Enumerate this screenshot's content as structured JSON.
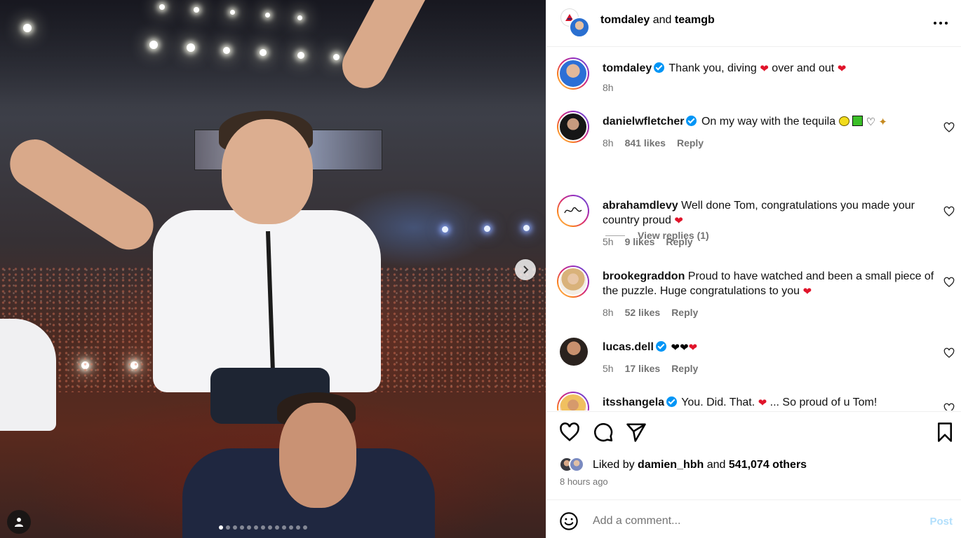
{
  "post": {
    "author_primary": "tomdaley",
    "joiner": "and",
    "author_secondary": "teamgb",
    "more_icon": "more-horizontal-icon"
  },
  "media": {
    "carousel_total": 13,
    "carousel_active_index": 0,
    "next_icon": "chevron-right-icon",
    "tag_icon": "user-tag-icon"
  },
  "caption": {
    "user": "tomdaley",
    "verified": true,
    "text_parts": [
      "Thank you, diving",
      "over and out"
    ],
    "time": "8h"
  },
  "comments": [
    {
      "user": "danielwfletcher",
      "verified": true,
      "text": "On my way with the tequila",
      "time": "8h",
      "likes": "841 likes",
      "reply": "Reply",
      "view_replies": "View replies (1)"
    },
    {
      "user": "abrahamdlevy",
      "verified": false,
      "text": "Well done Tom, congratulations you made your country proud",
      "time": "5h",
      "likes": "9 likes",
      "reply": "Reply"
    },
    {
      "user": "brookegraddon",
      "verified": false,
      "text": "Proud to have watched and been a small piece of the puzzle. Huge congratulations to you",
      "time": "8h",
      "likes": "52 likes",
      "reply": "Reply"
    },
    {
      "user": "lucas.dell",
      "verified": true,
      "text": "",
      "time": "5h",
      "likes": "17 likes",
      "reply": "Reply"
    },
    {
      "user": "itsshangela",
      "verified": true,
      "text_parts": [
        "You. Did. That.",
        "... So proud of u Tom!"
      ]
    }
  ],
  "actions": {
    "like_icon": "heart-icon",
    "comment_icon": "comment-icon",
    "share_icon": "send-icon",
    "save_icon": "bookmark-icon"
  },
  "likes_summary": {
    "prefix": "Liked by",
    "user": "damien_hbh",
    "joiner": "and",
    "others": "541,074 others",
    "time_ago": "8 hours ago"
  },
  "composer": {
    "placeholder": "Add a comment...",
    "post_label": "Post",
    "emoji_icon": "smiley-icon"
  },
  "colors": {
    "accent": "#0095f6",
    "post_disabled": "#b2dffc",
    "heart_red": "#e0142a",
    "muted": "#737373"
  }
}
